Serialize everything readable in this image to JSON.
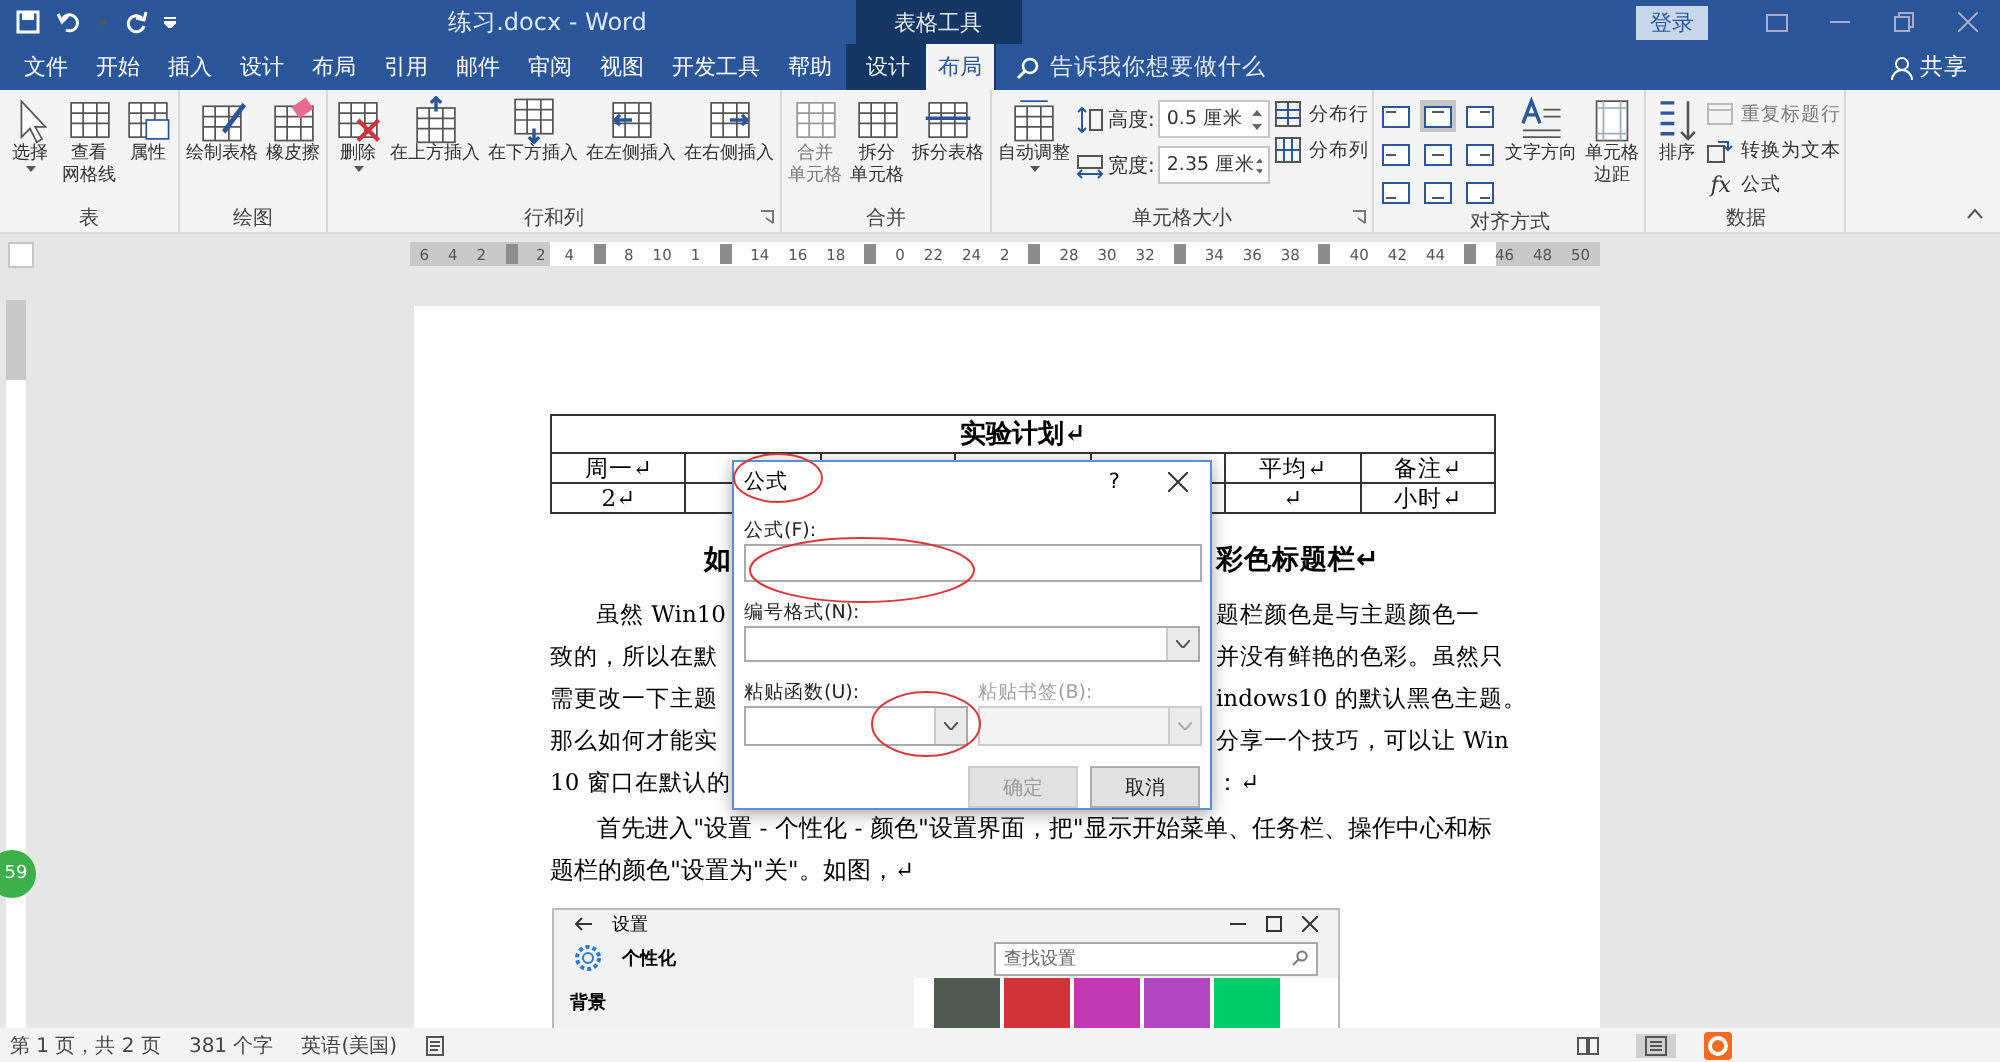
{
  "window": {
    "title": "练习.docx - Word",
    "context_title": "表格工具",
    "sign_in": "登录"
  },
  "tabs": [
    {
      "label": "文件",
      "selected": false,
      "contextual": false
    },
    {
      "label": "开始",
      "selected": false,
      "contextual": false
    },
    {
      "label": "插入",
      "selected": false,
      "contextual": false
    },
    {
      "label": "设计",
      "selected": false,
      "contextual": false
    },
    {
      "label": "布局",
      "selected": false,
      "contextual": false
    },
    {
      "label": "引用",
      "selected": false,
      "contextual": false
    },
    {
      "label": "邮件",
      "selected": false,
      "contextual": false
    },
    {
      "label": "审阅",
      "selected": false,
      "contextual": false
    },
    {
      "label": "视图",
      "selected": false,
      "contextual": false
    },
    {
      "label": "开发工具",
      "selected": false,
      "contextual": false
    },
    {
      "label": "帮助",
      "selected": false,
      "contextual": false
    },
    {
      "label": "设计",
      "selected": false,
      "contextual": true
    },
    {
      "label": "布局",
      "selected": true,
      "contextual": true
    }
  ],
  "tell_me": {
    "placeholder": "告诉我你想要做什么"
  },
  "share": "共享",
  "ribbon": {
    "groups": [
      {
        "label": "表",
        "launcher": false,
        "sections": [
          {
            "kind": "large",
            "buttons": [
              {
                "kind": "select",
                "label": [
                  "选择"
                ],
                "dropdown": true,
                "disabled": false
              },
              {
                "kind": "gridlines",
                "label": [
                  "查看",
                  "网格线"
                ],
                "dropdown": false,
                "disabled": false
              },
              {
                "kind": "properties",
                "label": [
                  "属性"
                ],
                "dropdown": false,
                "disabled": false
              }
            ]
          }
        ]
      },
      {
        "label": "绘图",
        "launcher": false,
        "sections": [
          {
            "kind": "large",
            "buttons": [
              {
                "kind": "draw",
                "label": [
                  "绘制表格"
                ],
                "dropdown": false,
                "disabled": false
              },
              {
                "kind": "eraser",
                "label": [
                  "橡皮擦"
                ],
                "dropdown": false,
                "disabled": false
              }
            ]
          }
        ]
      },
      {
        "label": "行和列",
        "launcher": true,
        "sections": [
          {
            "kind": "large",
            "buttons": [
              {
                "kind": "delete",
                "label": [
                  "删除"
                ],
                "dropdown": true,
                "disabled": false
              },
              {
                "kind": "insert-above",
                "label": [
                  "在上方插入"
                ],
                "dropdown": false,
                "disabled": false
              },
              {
                "kind": "insert-below",
                "label": [
                  "在下方插入"
                ],
                "dropdown": false,
                "disabled": false
              },
              {
                "kind": "insert-left",
                "label": [
                  "在左侧插入"
                ],
                "dropdown": false,
                "disabled": false
              },
              {
                "kind": "insert-right",
                "label": [
                  "在右侧插入"
                ],
                "dropdown": false,
                "disabled": false
              }
            ]
          }
        ]
      },
      {
        "label": "合并",
        "launcher": false,
        "sections": [
          {
            "kind": "large",
            "buttons": [
              {
                "kind": "merge",
                "label": [
                  "合并",
                  "单元格"
                ],
                "dropdown": false,
                "disabled": true
              },
              {
                "kind": "split-cells",
                "label": [
                  "拆分",
                  "单元格"
                ],
                "dropdown": false,
                "disabled": false
              },
              {
                "kind": "split-table",
                "label": [
                  "拆分表格"
                ],
                "dropdown": false,
                "disabled": false
              }
            ]
          }
        ]
      },
      {
        "label": "单元格大小",
        "launcher": true,
        "sections": [
          {
            "kind": "large",
            "buttons": [
              {
                "kind": "autofit",
                "label": [
                  "自动调整"
                ],
                "dropdown": true,
                "disabled": false
              }
            ]
          },
          {
            "kind": "spinners",
            "fields": [
              {
                "kind": "height",
                "label": "高度:",
                "value": "0.5 厘米"
              },
              {
                "kind": "width",
                "label": "宽度:",
                "value": "2.35 厘米"
              }
            ]
          },
          {
            "kind": "small",
            "buttons": [
              {
                "kind": "distribute-rows",
                "label": "分布行",
                "disabled": false
              },
              {
                "kind": "distribute-columns",
                "label": "分布列",
                "disabled": false
              }
            ]
          }
        ]
      },
      {
        "label": "对齐方式",
        "launcher": false,
        "sections": [
          {
            "kind": "align-grid",
            "cells": [
              {
                "selected": false
              },
              {
                "selected": true
              },
              {
                "selected": false
              },
              {
                "selected": false
              },
              {
                "selected": false
              },
              {
                "selected": false
              },
              {
                "selected": false
              },
              {
                "selected": false
              },
              {
                "selected": false
              }
            ]
          },
          {
            "kind": "large",
            "buttons": [
              {
                "kind": "text-direction",
                "label": [
                  "文字方向"
                ],
                "dropdown": false,
                "disabled": false
              },
              {
                "kind": "margins",
                "label": [
                  "单元格",
                  "边距"
                ],
                "dropdown": false,
                "disabled": false
              }
            ]
          }
        ]
      },
      {
        "label": "数据",
        "launcher": false,
        "sections": [
          {
            "kind": "large",
            "buttons": [
              {
                "kind": "sort",
                "label": [
                  "排序"
                ],
                "dropdown": false,
                "disabled": false
              }
            ]
          },
          {
            "kind": "small",
            "buttons": [
              {
                "kind": "repeat-header",
                "label": "重复标题行",
                "disabled": true
              },
              {
                "kind": "convert",
                "label": "转换为文本",
                "disabled": false
              },
              {
                "kind": "formula",
                "label": "公式",
                "glyph": "fx",
                "disabled": false
              }
            ]
          }
        ]
      }
    ]
  },
  "ruler": [
    {
      "kind": "num",
      "text": "6"
    },
    {
      "kind": "num",
      "text": "4"
    },
    {
      "kind": "num",
      "text": "2"
    },
    {
      "kind": "marker"
    },
    {
      "kind": "num",
      "text": "2"
    },
    {
      "kind": "num",
      "text": "4"
    },
    {
      "kind": "marker"
    },
    {
      "kind": "num",
      "text": "8"
    },
    {
      "kind": "num",
      "text": "10"
    },
    {
      "kind": "num",
      "text": "1"
    },
    {
      "kind": "marker"
    },
    {
      "kind": "num",
      "text": "14"
    },
    {
      "kind": "num",
      "text": "16"
    },
    {
      "kind": "num",
      "text": "18"
    },
    {
      "kind": "marker"
    },
    {
      "kind": "num",
      "text": "0"
    },
    {
      "kind": "num",
      "text": "22"
    },
    {
      "kind": "num",
      "text": "24"
    },
    {
      "kind": "num",
      "text": "2"
    },
    {
      "kind": "marker"
    },
    {
      "kind": "num",
      "text": "28"
    },
    {
      "kind": "num",
      "text": "30"
    },
    {
      "kind": "num",
      "text": "32"
    },
    {
      "kind": "marker"
    },
    {
      "kind": "num",
      "text": "34"
    },
    {
      "kind": "num",
      "text": "36"
    },
    {
      "kind": "num",
      "text": "38"
    },
    {
      "kind": "marker"
    },
    {
      "kind": "num",
      "text": "40"
    },
    {
      "kind": "num",
      "text": "42"
    },
    {
      "kind": "num",
      "text": "44"
    },
    {
      "kind": "marker"
    },
    {
      "kind": "num",
      "text": "46"
    },
    {
      "kind": "num",
      "text": "48"
    },
    {
      "kind": "num",
      "text": "50"
    }
  ],
  "document": {
    "table": {
      "title": "实验计划↵",
      "rows": [
        [
          {
            "text": "周一↵"
          },
          {},
          {},
          {},
          {},
          {
            "text": "平均↵"
          },
          {
            "text": "备注↵"
          }
        ],
        [
          {
            "text": "2↵"
          },
          {},
          {},
          {},
          {},
          {
            "text": "↵"
          },
          {
            "text": "小时↵"
          }
        ]
      ]
    },
    "heading": {
      "left": "如",
      "right": "彩色标题栏↵"
    },
    "paragraph_lines": [
      {
        "left": "虽然 Win10",
        "right": "题栏颜色是与主题颜色一",
        "indent": true
      },
      {
        "left": "致的，所以在默",
        "right": "并没有鲜艳的色彩。虽然只",
        "indent": false
      },
      {
        "left": "需更改一下主题",
        "right": "indows10 的默认黑色主题。",
        "indent": false
      },
      {
        "left": "那么如何才能实",
        "right": "分享一个技巧，可以让 Win",
        "indent": false
      },
      {
        "left": "10 窗口在默认的",
        "right": "：↵",
        "indent": false
      }
    ],
    "paragraph": "首先进入\"设置 - 个性化 - 颜色\"设置界面，把\"显示开始菜单、任务栏、操作中心和标题栏的颜色\"设置为\"关\"。如图，↵",
    "settings_window": {
      "title": "设置",
      "page": "个性化",
      "search_placeholder": "查找设置",
      "nav": [
        "背景"
      ],
      "swatches": [
        {
          "color": "#4f5a52"
        },
        {
          "color": "#d13438"
        },
        {
          "color": "#c239b3"
        },
        {
          "color": "#b146c2"
        },
        {
          "color": "#00cc6a"
        }
      ]
    }
  },
  "dialog": {
    "title": "公式",
    "help": "?",
    "formula_label": "公式(F):",
    "number_format_label": "编号格式(N):",
    "paste": [
      {
        "label": "粘贴函数(U):",
        "disabled": false
      },
      {
        "label": "粘贴书签(B):",
        "disabled": true
      }
    ],
    "buttons": [
      {
        "label": "确定",
        "disabled": true
      },
      {
        "label": "取消",
        "disabled": false
      }
    ]
  },
  "badge": "59",
  "status_bar": {
    "items": [
      "第 1 页，共 2 页",
      "381 个字",
      "英语(美国)"
    ]
  }
}
